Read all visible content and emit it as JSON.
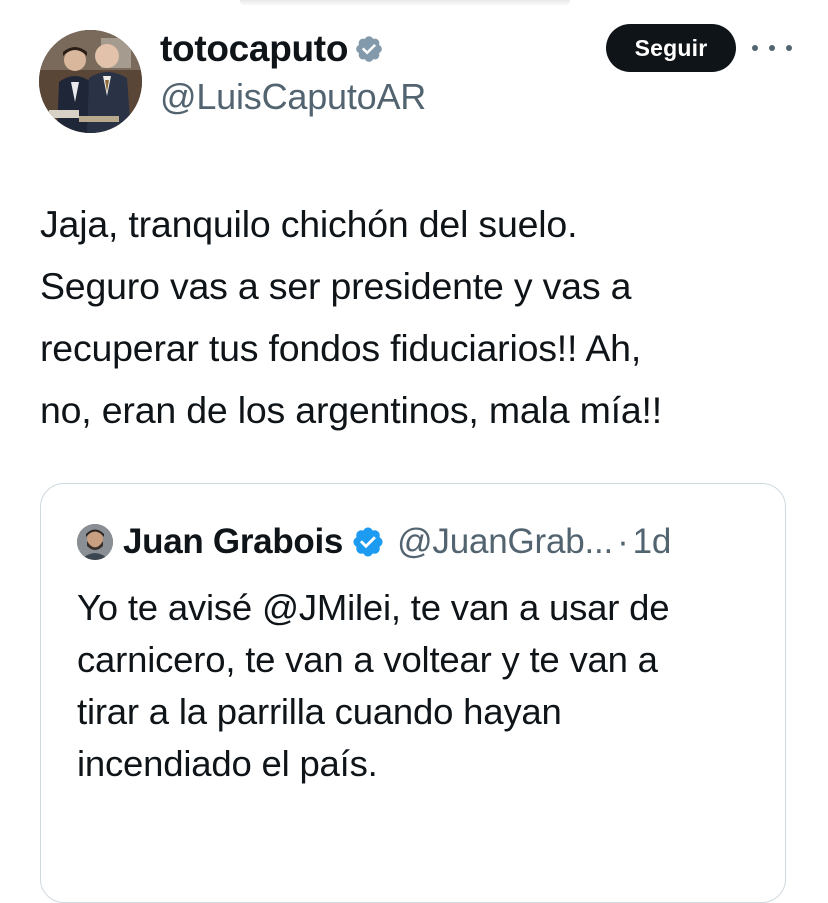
{
  "tweet": {
    "author": {
      "display_name": "totocaputo",
      "handle": "@LuisCaputoAR",
      "verified_icon": "verified-badge-icon",
      "verified_color": "#829aab"
    },
    "follow_label": "Seguir",
    "more_icon": "more-options-icon",
    "text_lines": [
      "Jaja, tranquilo chichón del suelo.",
      "Seguro vas a ser presidente y vas a",
      "recuperar tus fondos fiduciarios!! Ah,",
      "no, eran de los argentinos, mala mía!!"
    ]
  },
  "quote": {
    "author": {
      "display_name": "Juan Grabois",
      "handle": "@JuanGrab...",
      "verified_icon": "verified-badge-icon",
      "verified_color": "#1d9bf0"
    },
    "separator": "·",
    "time": "1d",
    "text_lines": [
      "Yo te avisé @JMilei, te van a usar de",
      "carnicero, te van a voltear y te van a",
      "tirar a la parrilla cuando hayan",
      "incendiado el país."
    ]
  },
  "colors": {
    "text_primary": "#0f1419",
    "text_secondary": "#536471",
    "follow_button_bg": "#0f1419",
    "card_border": "#cfd9de"
  }
}
